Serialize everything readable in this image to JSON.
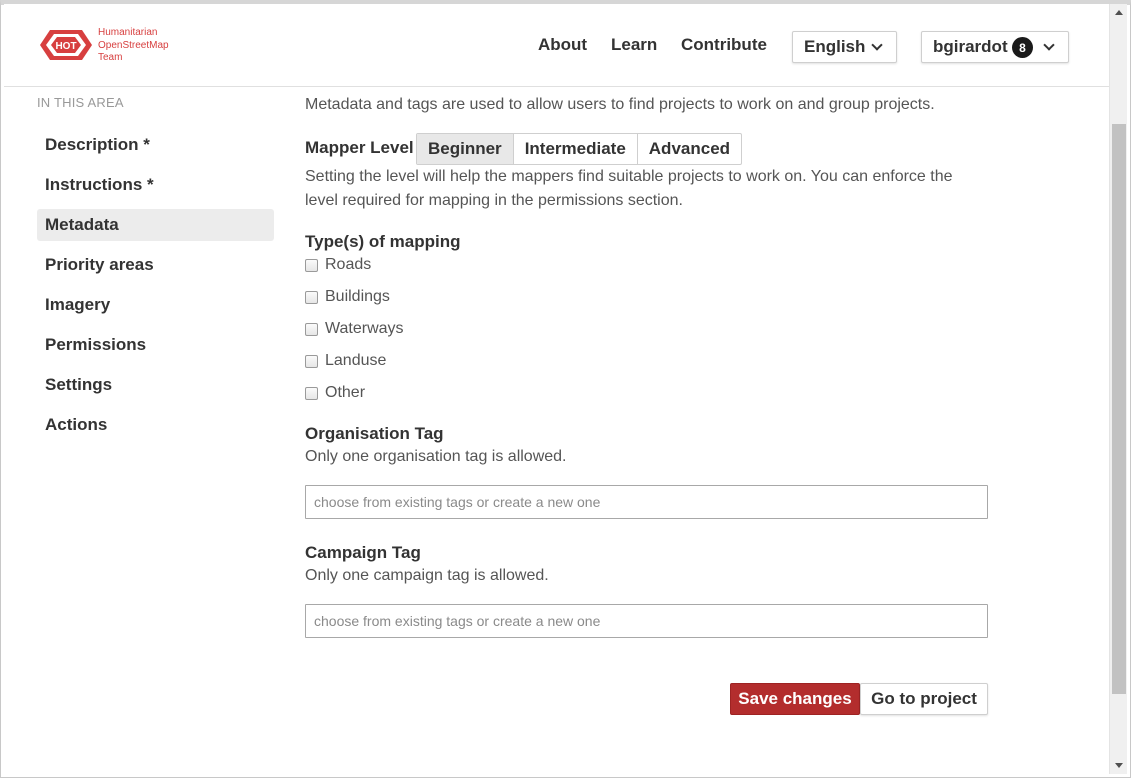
{
  "header": {
    "logo_lines": [
      "Humanitarian",
      "OpenStreetMap",
      "Team"
    ],
    "logo_badge": "HOT",
    "nav": {
      "about": "About",
      "learn": "Learn",
      "contribute": "Contribute"
    },
    "language": "English",
    "user": {
      "name": "bgirardot",
      "notifications": "8"
    }
  },
  "sidebar": {
    "heading": "IN THIS AREA",
    "items": [
      {
        "label": "Description *"
      },
      {
        "label": "Instructions *"
      },
      {
        "label": "Metadata",
        "active": true
      },
      {
        "label": "Priority areas"
      },
      {
        "label": "Imagery"
      },
      {
        "label": "Permissions"
      },
      {
        "label": "Settings"
      },
      {
        "label": "Actions"
      }
    ]
  },
  "main": {
    "intro": "Metadata and tags are used to allow users to find projects to work on and group projects.",
    "mapper_level": {
      "label": "Mapper Level",
      "options": [
        "Beginner",
        "Intermediate",
        "Advanced"
      ],
      "selected": "Beginner",
      "help_line1": "Setting the level will help the mappers find suitable projects to work on. You can enforce the",
      "help_line2": "level required for mapping in the permissions section."
    },
    "mapping_types": {
      "label": "Type(s) of mapping",
      "options": [
        "Roads",
        "Buildings",
        "Waterways",
        "Landuse",
        "Other"
      ]
    },
    "organisation_tag": {
      "label": "Organisation Tag",
      "help": "Only one organisation tag is allowed.",
      "placeholder": "choose from existing tags or create a new one"
    },
    "campaign_tag": {
      "label": "Campaign Tag",
      "help": "Only one campaign tag is allowed.",
      "placeholder": "choose from existing tags or create a new one"
    },
    "buttons": {
      "save": "Save changes",
      "go": "Go to project"
    }
  },
  "colors": {
    "brand_red": "#d73f3f",
    "save_button": "#b32d2d"
  }
}
